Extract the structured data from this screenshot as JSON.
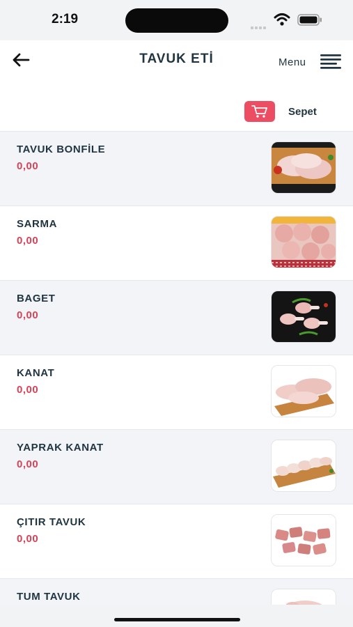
{
  "status_bar": {
    "time": "2:19"
  },
  "header": {
    "title": "TAVUK ETİ",
    "menu_label": "Menu",
    "back_icon": "arrow-left-icon",
    "menu_icon": "hamburger-icon"
  },
  "cart": {
    "label": "Sepet",
    "icon": "cart-icon",
    "color": "#ec4d63"
  },
  "colors": {
    "title": "#1f3440",
    "price": "#d64256",
    "row_alt_background": "#f2f4f8"
  },
  "products": [
    {
      "name": "TAVUK BONFİLE",
      "price": "0,00",
      "image": "chicken-breast-photo"
    },
    {
      "name": "SARMA",
      "price": "0,00",
      "image": "chicken-rolls-photo"
    },
    {
      "name": "BAGET",
      "price": "0,00",
      "image": "drumsticks-photo"
    },
    {
      "name": "KANAT",
      "price": "0,00",
      "image": "chicken-wings-photo"
    },
    {
      "name": "YAPRAK KANAT",
      "price": "0,00",
      "image": "flat-wings-photo"
    },
    {
      "name": "ÇITIR TAVUK",
      "price": "0,00",
      "image": "crispy-chicken-photo"
    },
    {
      "name": "TUM TAVUK",
      "price": "",
      "image": "whole-chicken-photo"
    }
  ]
}
